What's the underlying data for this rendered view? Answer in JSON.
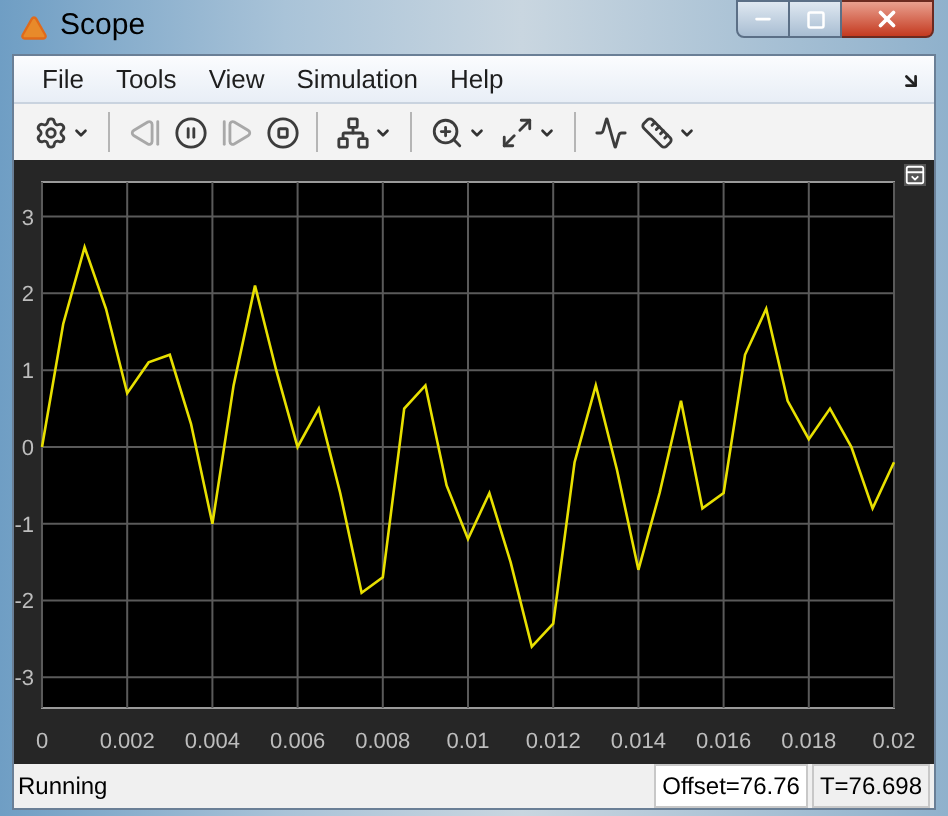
{
  "window": {
    "title": "Scope"
  },
  "menu": [
    {
      "label": "File"
    },
    {
      "label": "Tools"
    },
    {
      "label": "View"
    },
    {
      "label": "Simulation"
    },
    {
      "label": "Help"
    }
  ],
  "toolbar": [
    {
      "kind": "settings",
      "dropdown": true,
      "disabled": false
    },
    {
      "kind": "separator"
    },
    {
      "kind": "step-back",
      "dropdown": false,
      "disabled": true
    },
    {
      "kind": "pause",
      "dropdown": false,
      "disabled": false
    },
    {
      "kind": "step-forward",
      "dropdown": false,
      "disabled": true
    },
    {
      "kind": "stop",
      "dropdown": false,
      "disabled": false
    },
    {
      "kind": "separator"
    },
    {
      "kind": "highlight",
      "dropdown": true,
      "disabled": false
    },
    {
      "kind": "separator"
    },
    {
      "kind": "zoom",
      "dropdown": true,
      "disabled": false
    },
    {
      "kind": "fit",
      "dropdown": true,
      "disabled": false
    },
    {
      "kind": "separator"
    },
    {
      "kind": "signal",
      "dropdown": false,
      "disabled": false
    },
    {
      "kind": "measure",
      "dropdown": true,
      "disabled": false
    }
  ],
  "plot": {
    "chart_data": {
      "type": "line",
      "grid": true,
      "xlim": [
        0,
        0.02
      ],
      "ylim": [
        -3.4,
        3.45
      ],
      "xticks": [
        {
          "value": 0,
          "label": "0"
        },
        {
          "value": 0.002,
          "label": "0.002"
        },
        {
          "value": 0.004,
          "label": "0.004"
        },
        {
          "value": 0.006,
          "label": "0.006"
        },
        {
          "value": 0.008,
          "label": "0.008"
        },
        {
          "value": 0.01,
          "label": "0.01"
        },
        {
          "value": 0.012,
          "label": "0.012"
        },
        {
          "value": 0.014,
          "label": "0.014"
        },
        {
          "value": 0.016,
          "label": "0.016"
        },
        {
          "value": 0.018,
          "label": "0.018"
        },
        {
          "value": 0.02,
          "label": "0.02"
        }
      ],
      "yticks": [
        {
          "value": -3,
          "label": "-3"
        },
        {
          "value": -2,
          "label": "-2"
        },
        {
          "value": -1,
          "label": "-1"
        },
        {
          "value": 0,
          "label": "0"
        },
        {
          "value": 1,
          "label": "1"
        },
        {
          "value": 2,
          "label": "2"
        },
        {
          "value": 3,
          "label": "3"
        }
      ],
      "x": [
        0,
        0.0005,
        0.001,
        0.0015,
        0.002,
        0.0025,
        0.003,
        0.0035,
        0.004,
        0.0045,
        0.005,
        0.0055,
        0.006,
        0.0065,
        0.007,
        0.0075,
        0.008,
        0.0085,
        0.009,
        0.0095,
        0.01,
        0.0105,
        0.011,
        0.0115,
        0.012,
        0.0125,
        0.013,
        0.0135,
        0.014,
        0.0145,
        0.015,
        0.0155,
        0.016,
        0.0165,
        0.017,
        0.0175,
        0.018,
        0.0185,
        0.019,
        0.0195,
        0.02
      ],
      "series": [
        {
          "color": "#e8e000",
          "values": [
            0,
            1.6,
            2.6,
            1.8,
            0.7,
            1.1,
            1.2,
            0.3,
            -1.0,
            0.8,
            2.1,
            1.0,
            0.0,
            0.5,
            -0.6,
            -1.9,
            -1.7,
            0.5,
            0.8,
            -0.5,
            -1.2,
            -0.6,
            -1.5,
            -2.6,
            -2.3,
            -0.2,
            0.8,
            -0.3,
            -1.6,
            -0.6,
            0.6,
            -0.8,
            -0.6,
            1.2,
            1.8,
            0.6,
            0.1,
            0.5,
            0.0,
            -0.8,
            -0.2
          ]
        }
      ]
    }
  },
  "status_bar": {
    "message": "Running",
    "offset": "Offset=76.76",
    "time": "T=76.698"
  }
}
